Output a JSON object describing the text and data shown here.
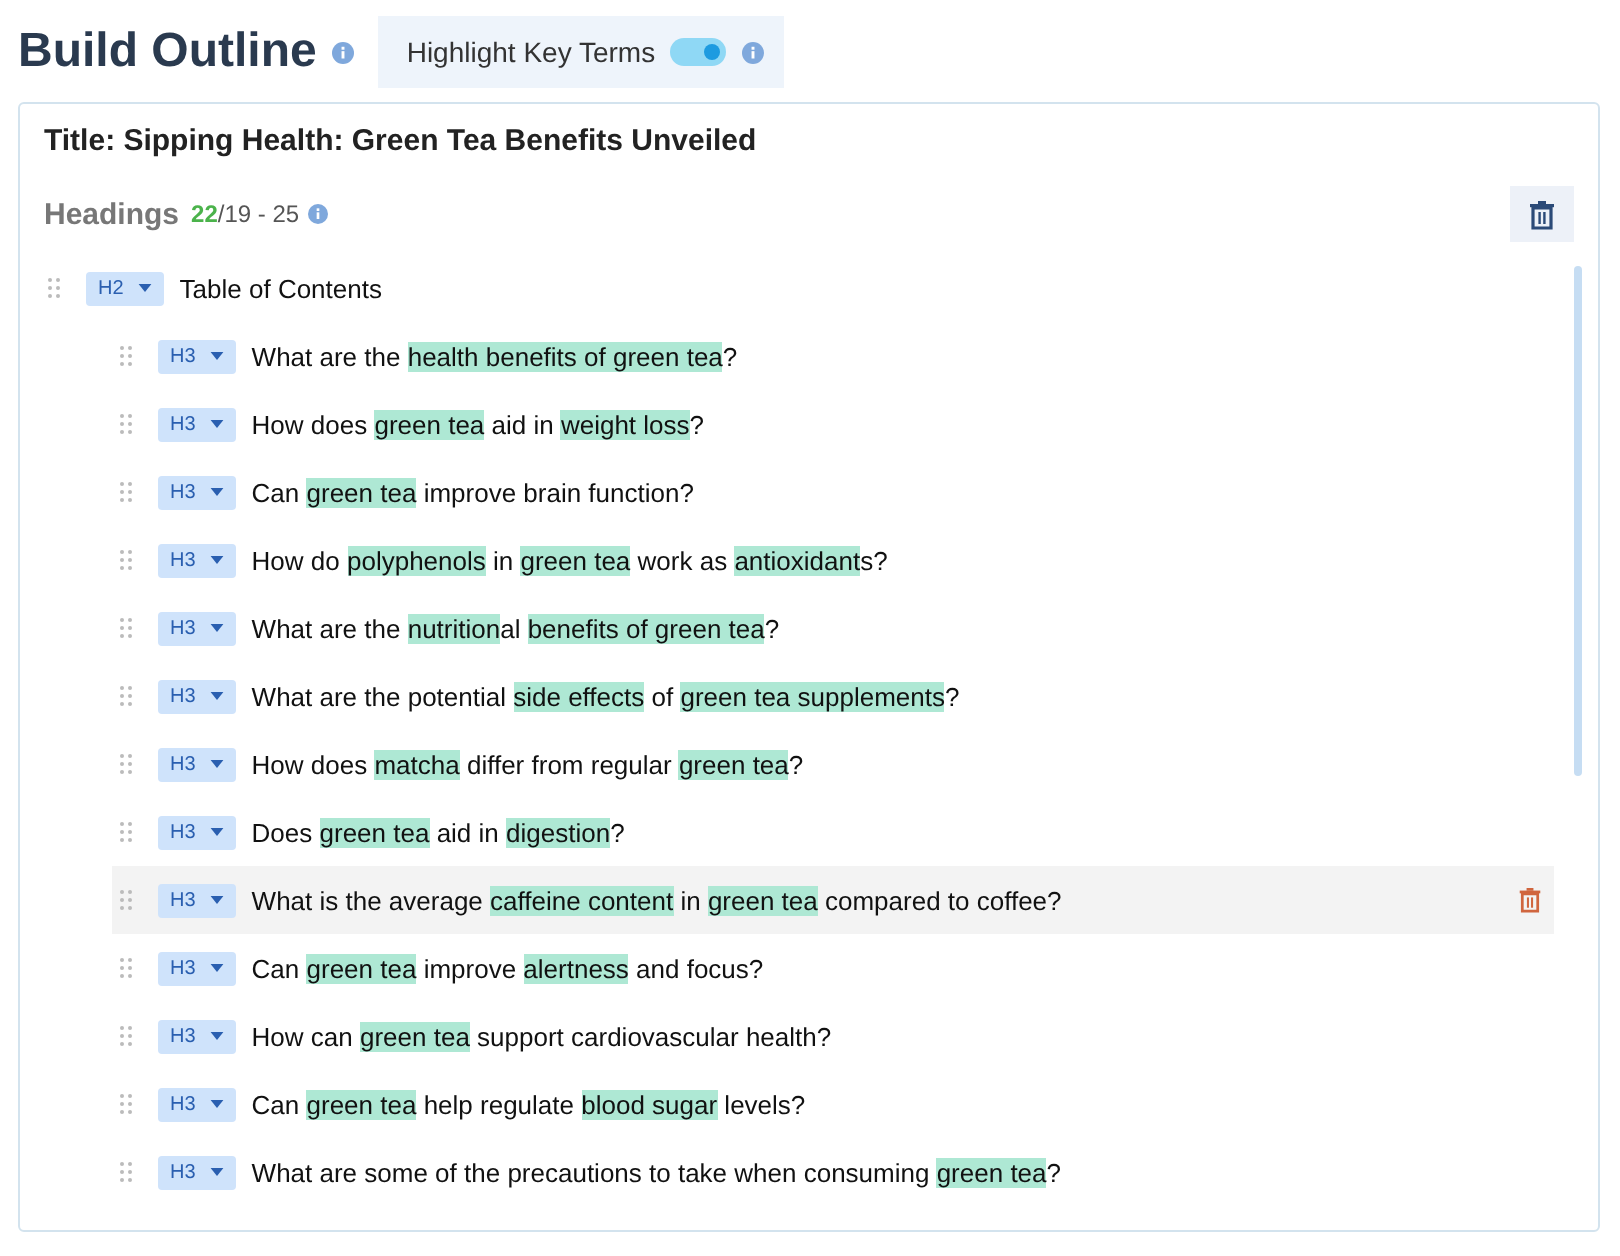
{
  "page_title": "Build Outline",
  "highlight_toggle": {
    "label": "Highlight Key Terms",
    "on": true
  },
  "outline": {
    "title": "Title: Sipping Health: Green Tea Benefits Unveiled",
    "headings_label": "Headings",
    "count_current": "22",
    "count_range": "/19 - 25",
    "headings": [
      {
        "level": "H2",
        "hovered": false,
        "segments": [
          {
            "text": "Table of Contents",
            "key_term": false
          }
        ],
        "children": [
          {
            "level": "H3",
            "hovered": false,
            "segments": [
              {
                "text": "What are the ",
                "key_term": false
              },
              {
                "text": "health benefits of green tea",
                "key_term": true
              },
              {
                "text": "?",
                "key_term": false
              }
            ]
          },
          {
            "level": "H3",
            "hovered": false,
            "segments": [
              {
                "text": "How does ",
                "key_term": false
              },
              {
                "text": "green tea",
                "key_term": true
              },
              {
                "text": " aid in ",
                "key_term": false
              },
              {
                "text": "weight loss",
                "key_term": true
              },
              {
                "text": "?",
                "key_term": false
              }
            ]
          },
          {
            "level": "H3",
            "hovered": false,
            "segments": [
              {
                "text": "Can ",
                "key_term": false
              },
              {
                "text": "green tea",
                "key_term": true
              },
              {
                "text": " improve brain function?",
                "key_term": false
              }
            ]
          },
          {
            "level": "H3",
            "hovered": false,
            "segments": [
              {
                "text": "How do ",
                "key_term": false
              },
              {
                "text": "polyphenols",
                "key_term": true
              },
              {
                "text": " in ",
                "key_term": false
              },
              {
                "text": "green tea",
                "key_term": true
              },
              {
                "text": " work as ",
                "key_term": false
              },
              {
                "text": "antioxidant",
                "key_term": true
              },
              {
                "text": "s?",
                "key_term": false
              }
            ]
          },
          {
            "level": "H3",
            "hovered": false,
            "segments": [
              {
                "text": "What are the ",
                "key_term": false
              },
              {
                "text": "nutrition",
                "key_term": true
              },
              {
                "text": "al ",
                "key_term": false
              },
              {
                "text": "benefits of green tea",
                "key_term": true
              },
              {
                "text": "?",
                "key_term": false
              }
            ]
          },
          {
            "level": "H3",
            "hovered": false,
            "segments": [
              {
                "text": "What are the potential ",
                "key_term": false
              },
              {
                "text": "side effects",
                "key_term": true
              },
              {
                "text": " of ",
                "key_term": false
              },
              {
                "text": "green tea",
                "key_term": true
              },
              {
                "text": " supplements",
                "key_term": true
              },
              {
                "text": "?",
                "key_term": false
              }
            ]
          },
          {
            "level": "H3",
            "hovered": false,
            "segments": [
              {
                "text": "How does ",
                "key_term": false
              },
              {
                "text": "matcha",
                "key_term": true
              },
              {
                "text": " differ from regular ",
                "key_term": false
              },
              {
                "text": "green tea",
                "key_term": true
              },
              {
                "text": "?",
                "key_term": false
              }
            ]
          },
          {
            "level": "H3",
            "hovered": false,
            "segments": [
              {
                "text": "Does ",
                "key_term": false
              },
              {
                "text": "green tea",
                "key_term": true
              },
              {
                "text": " aid in ",
                "key_term": false
              },
              {
                "text": "digestion",
                "key_term": true
              },
              {
                "text": "?",
                "key_term": false
              }
            ]
          },
          {
            "level": "H3",
            "hovered": true,
            "segments": [
              {
                "text": "What is the average ",
                "key_term": false
              },
              {
                "text": "caffeine content",
                "key_term": true
              },
              {
                "text": " in ",
                "key_term": false
              },
              {
                "text": "green tea",
                "key_term": true
              },
              {
                "text": " compared to coffee?",
                "key_term": false
              }
            ]
          },
          {
            "level": "H3",
            "hovered": false,
            "segments": [
              {
                "text": "Can ",
                "key_term": false
              },
              {
                "text": "green tea",
                "key_term": true
              },
              {
                "text": " improve ",
                "key_term": false
              },
              {
                "text": "alertness",
                "key_term": true
              },
              {
                "text": " and focus?",
                "key_term": false
              }
            ]
          },
          {
            "level": "H3",
            "hovered": false,
            "segments": [
              {
                "text": "How can ",
                "key_term": false
              },
              {
                "text": "green tea",
                "key_term": true
              },
              {
                "text": " support cardiovascular health?",
                "key_term": false
              }
            ]
          },
          {
            "level": "H3",
            "hovered": false,
            "segments": [
              {
                "text": "Can ",
                "key_term": false
              },
              {
                "text": "green tea",
                "key_term": true
              },
              {
                "text": " help regulate ",
                "key_term": false
              },
              {
                "text": "blood sugar",
                "key_term": true
              },
              {
                "text": " levels?",
                "key_term": false
              }
            ]
          },
          {
            "level": "H3",
            "hovered": false,
            "segments": [
              {
                "text": "What are some of the precautions to take when consuming ",
                "key_term": false
              },
              {
                "text": "green tea",
                "key_term": true
              },
              {
                "text": "?",
                "key_term": false
              }
            ]
          }
        ]
      }
    ]
  }
}
